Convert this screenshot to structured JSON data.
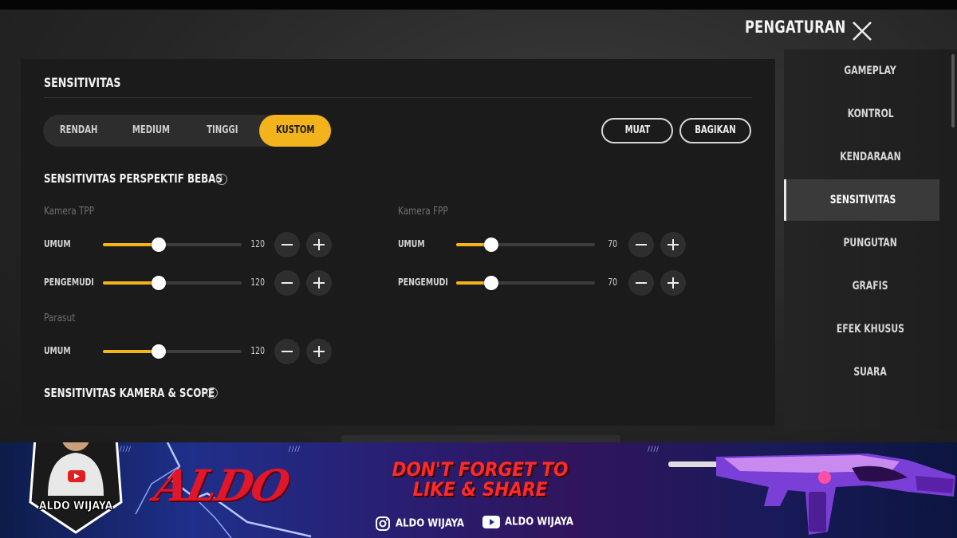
{
  "header": {
    "title": "PENGATURAN",
    "close_icon": "close-icon"
  },
  "panel": {
    "title": "SENSITIVITAS",
    "presets": [
      {
        "label": "RENDAH",
        "active": false
      },
      {
        "label": "MEDIUM",
        "active": false
      },
      {
        "label": "TINGGI",
        "active": false
      },
      {
        "label": "KUSTOM",
        "active": true
      }
    ],
    "load_button": "MUAT",
    "share_button": "BAGIKAN",
    "free_look": {
      "title": "SENSITIVITAS PERSPEKTIF BEBAS",
      "tpp": {
        "label": "Kamera TPP",
        "rows": [
          {
            "label": "UMUM",
            "value": "120",
            "level": 0.4
          },
          {
            "label": "PENGEMUDI",
            "value": "120",
            "level": 0.4
          }
        ]
      },
      "fpp": {
        "label": "Kamera FPP",
        "rows": [
          {
            "label": "UMUM",
            "value": "70",
            "level": 0.25
          },
          {
            "label": "PENGEMUDI",
            "value": "70",
            "level": 0.25
          }
        ]
      },
      "parachute": {
        "label": "Parasut",
        "rows": [
          {
            "label": "UMUM",
            "value": "120",
            "level": 0.4
          }
        ]
      }
    },
    "camera_scope": {
      "title": "SENSITIVITAS KAMERA & SCOPE"
    }
  },
  "sidebar": {
    "items": [
      {
        "label": "GAMEPLAY",
        "active": false
      },
      {
        "label": "KONTROL",
        "active": false
      },
      {
        "label": "KENDARAAN",
        "active": false
      },
      {
        "label": "SENSITIVITAS",
        "active": true
      },
      {
        "label": "PUNGUTAN",
        "active": false
      },
      {
        "label": "GRAFIS",
        "active": false
      },
      {
        "label": "EFEK KHUSUS",
        "active": false
      },
      {
        "label": "SUARA",
        "active": false
      }
    ]
  },
  "banner": {
    "name": "ALDO WIJAYA",
    "logo": "ALDO",
    "cta_line1": "DON'T FORGET TO",
    "cta_line2": "LIKE & SHARE",
    "instagram": "ALDO WIJAYA",
    "youtube": "ALDO WIJAYA"
  },
  "colors": {
    "accent": "#f2b31c",
    "panel": "#1b1b1b",
    "track": "#3d3d3d",
    "cta": "#ff2a2a"
  }
}
